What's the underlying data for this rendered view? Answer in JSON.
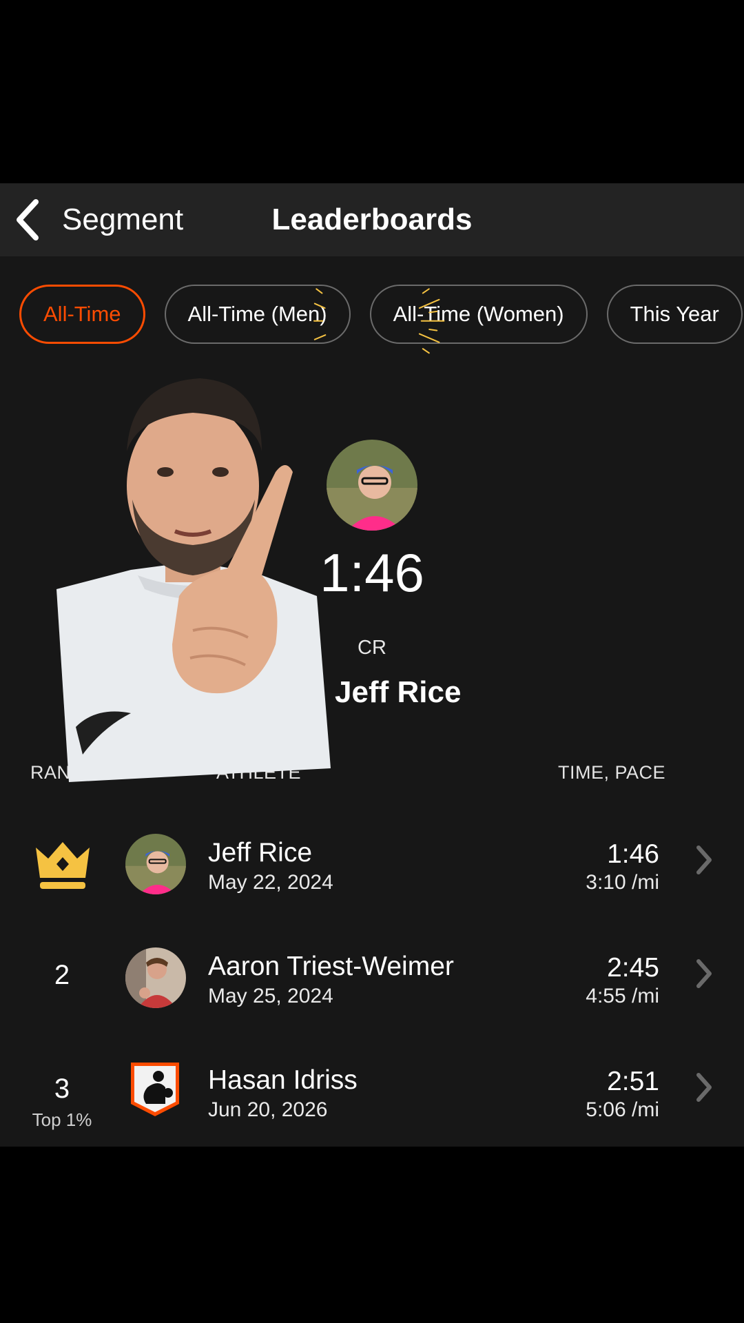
{
  "header": {
    "back_label": "Segment",
    "title": "Leaderboards"
  },
  "filters": [
    {
      "label": "All-Time",
      "active": true
    },
    {
      "label": "All-Time (Men)",
      "active": false
    },
    {
      "label": "All-Time (Women)",
      "active": false
    },
    {
      "label": "This Year",
      "active": false
    }
  ],
  "course_record": {
    "time": "1:46",
    "label": "CR",
    "athlete": "Jeff Rice"
  },
  "columns": {
    "rank": "RANK",
    "athlete": "ATHLETE",
    "time_pace": "TIME, PACE"
  },
  "rows": [
    {
      "rank": "",
      "rank_icon": "crown-icon",
      "rank_sub": "",
      "name": "Jeff Rice",
      "date": "May 22, 2024",
      "time": "1:46",
      "pace": "3:10 /mi"
    },
    {
      "rank": "2",
      "rank_icon": "",
      "rank_sub": "",
      "name": "Aaron Triest-Weimer",
      "date": "May 25, 2024",
      "time": "2:45",
      "pace": "4:55 /mi"
    },
    {
      "rank": "3",
      "rank_icon": "",
      "rank_sub": "Top 1%",
      "name": "Hasan Idriss",
      "date": "Jun 20, 2026",
      "time": "2:51",
      "pace": "5:06 /mi"
    }
  ],
  "colors": {
    "accent": "#fc4c02",
    "gold": "#f5c242",
    "background": "#171717",
    "header": "#232323"
  }
}
